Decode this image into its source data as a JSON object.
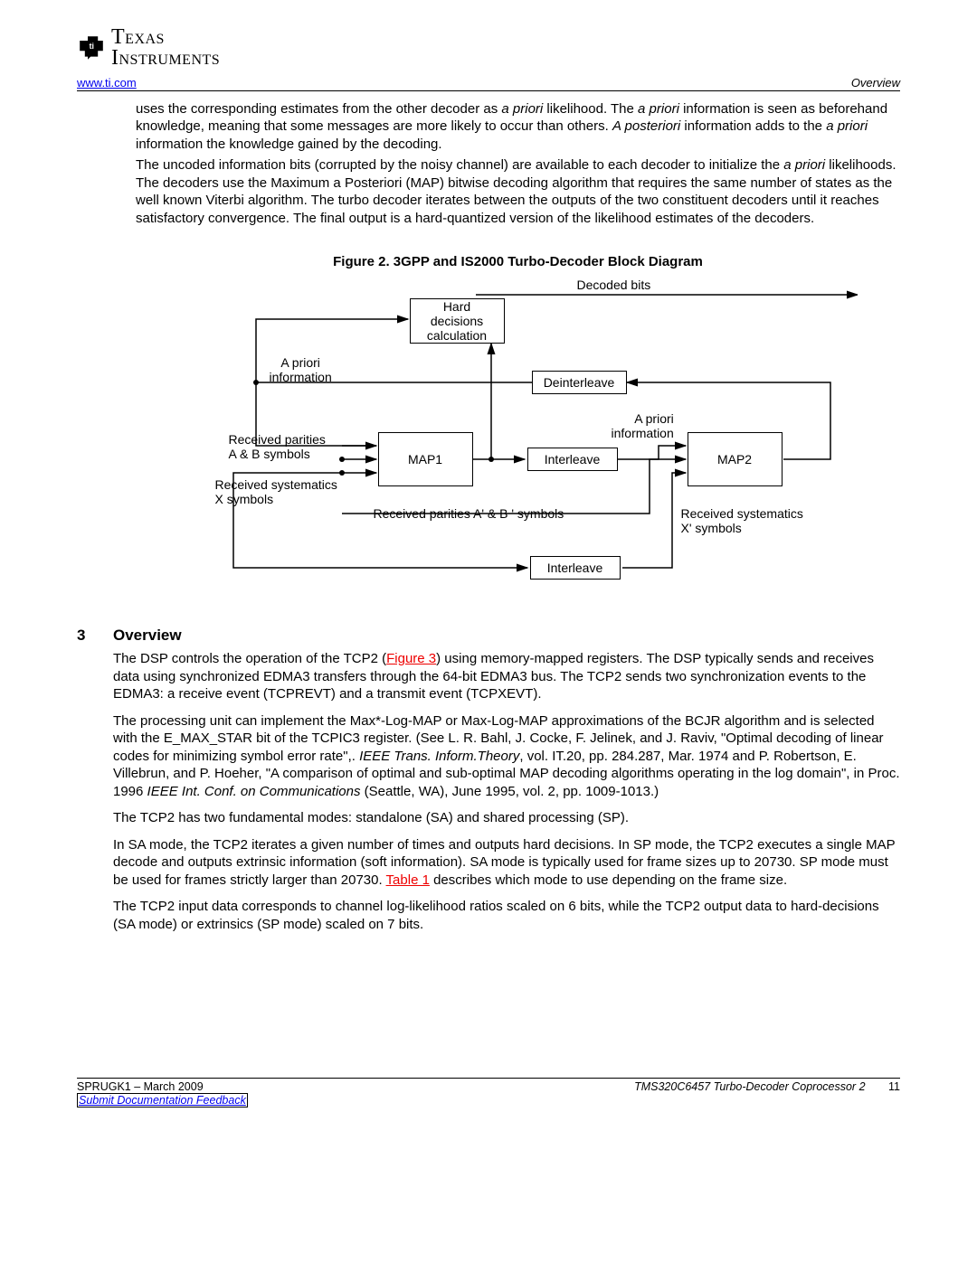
{
  "header": {
    "url": "www.ti.com",
    "section": "Overview"
  },
  "logo": {
    "line1": "TEXAS",
    "line2": "INSTRUMENTS"
  },
  "paragraphs": {
    "p1_seg1": "uses the corresponding estimates from the other decoder as ",
    "p1_apriori1": "a priori",
    "p1_seg2": " likelihood. The ",
    "p1_apriori2": "a priori",
    "p1_seg3": " information is seen as beforehand knowledge, meaning that some messages are more likely to occur than others. ",
    "p1_aposteriori": "A posteriori",
    "p1_seg4": " information adds to the ",
    "p1_apriori3": "a priori",
    "p1_seg5": " information the knowledge gained by the decoding.",
    "p2_seg1": "The uncoded information bits (corrupted by the noisy channel) are available to each decoder to initialize the ",
    "p2_apriori": "a priori",
    "p2_seg2": " likelihoods. The decoders use the Maximum a Posteriori (MAP) bitwise decoding algorithm that requires the same number of states as the well known Viterbi algorithm. The turbo decoder iterates between the outputs of the two constituent decoders until it reaches satisfactory convergence. The final output is a hard-quantized version of the likelihood estimates of the decoders."
  },
  "figure": {
    "caption": "Figure 2. 3GPP and IS2000 Turbo-Decoder Block Diagram",
    "labels": {
      "decoded_bits": "Decoded bits",
      "hard_decisions": "Hard\ndecisions\ncalculation",
      "apriori_left": "A priori\ninformation",
      "deinterleave": "Deinterleave",
      "received_parities_ab": "Received parities\nA & B symbols",
      "apriori_right": "A priori\ninformation",
      "map1": "MAP1",
      "interleave_mid": "Interleave",
      "map2": "MAP2",
      "received_systematics_x": "Received systematics\nX symbols",
      "received_parities_ab_prime": "Received parities A' & B ' symbols",
      "received_systematics_xprime": "Received systematics\nX' symbols",
      "interleave_bottom": "Interleave"
    }
  },
  "section": {
    "number": "3",
    "title": "Overview"
  },
  "section_paras": {
    "sp1_seg1": "The DSP controls the operation of the TCP2 (",
    "sp1_link": "Figure 3",
    "sp1_seg2": ") using memory-mapped registers. The DSP typically sends and receives data using synchronized EDMA3 transfers through the 64-bit EDMA3 bus. The TCP2 sends two synchronization events to the EDMA3: a receive event (TCPREVT) and a transmit event (TCPXEVT).",
    "sp2_seg1": "The processing unit can implement the Max*-Log-MAP or Max-Log-MAP approximations of the BCJR algorithm and is selected with the E_MAX_STAR bit of the TCPIC3 register. (See L. R. Bahl, J. Cocke, F. Jelinek, and J. Raviv, \"Optimal decoding of linear codes for minimizing symbol error rate\",. ",
    "sp2_it1": "IEEE Trans. Inform.Theory",
    "sp2_seg2": ", vol. IT.20, pp. 284.287, Mar. 1974 and P. Robertson, E. Villebrun, and P. Hoeher, \"A comparison of optimal and sub-optimal MAP decoding algorithms operating in the log domain\", in Proc. 1996 ",
    "sp2_it2": "IEEE Int. Conf. on Communications",
    "sp2_seg3": " (Seattle, WA), June 1995, vol. 2, pp. 1009-1013.)",
    "sp3": "The TCP2 has two fundamental modes: standalone (SA) and shared processing (SP).",
    "sp4_seg1": "In SA mode, the TCP2 iterates a given number of times and outputs hard decisions. In SP mode, the TCP2 executes a single MAP decode and outputs extrinsic information (soft information). SA mode is typically used for frame sizes up to 20730. SP mode must be used for frames strictly larger than 20730. ",
    "sp4_link": "Table 1",
    "sp4_seg2": " describes which mode to use depending on the frame size.",
    "sp5": "The TCP2 input data corresponds to channel log-likelihood ratios scaled on 6 bits, while the TCP2 output data to hard-decisions (SA mode) or extrinsics (SP mode) scaled on 7 bits."
  },
  "footer": {
    "left": "SPRUGK1 – March 2009",
    "right_title": "TMS320C6457 Turbo-Decoder Coprocessor 2",
    "page_number": "11",
    "feedback": "Submit Documentation Feedback"
  }
}
